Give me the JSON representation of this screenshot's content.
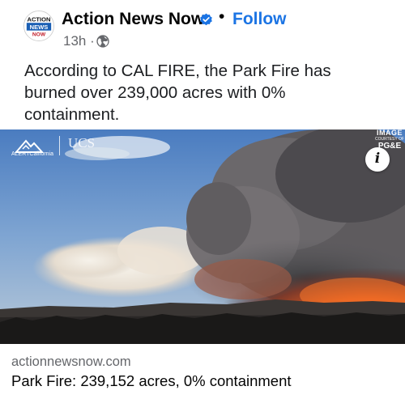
{
  "post": {
    "author_name": "Action News Now",
    "follow_label": "Follow",
    "separator": "•",
    "timestamp": "13h ·",
    "audience_icon": "globe-icon",
    "verified_icon": "verified-badge-icon",
    "text": "According to CAL FIRE, the Park Fire has burned over 239,000 acres with 0% containment."
  },
  "avatar": {
    "logo_line1": "ACTION",
    "logo_line2": "NEWS",
    "logo_line3": "NOW"
  },
  "media": {
    "watermark_left": "ALERTCalifornia",
    "watermark_ucsd": "UCS",
    "courtesy_line1": "IMAGE",
    "courtesy_line2": "COURTESY OF",
    "courtesy_line3": "PG&E",
    "info_label": "i"
  },
  "link": {
    "domain": "actionnewsnow.com",
    "title": "Park Fire: 239,152 acres, 0% containment"
  },
  "colors": {
    "accent": "#1b74e4",
    "secondary_text": "#65676b"
  }
}
